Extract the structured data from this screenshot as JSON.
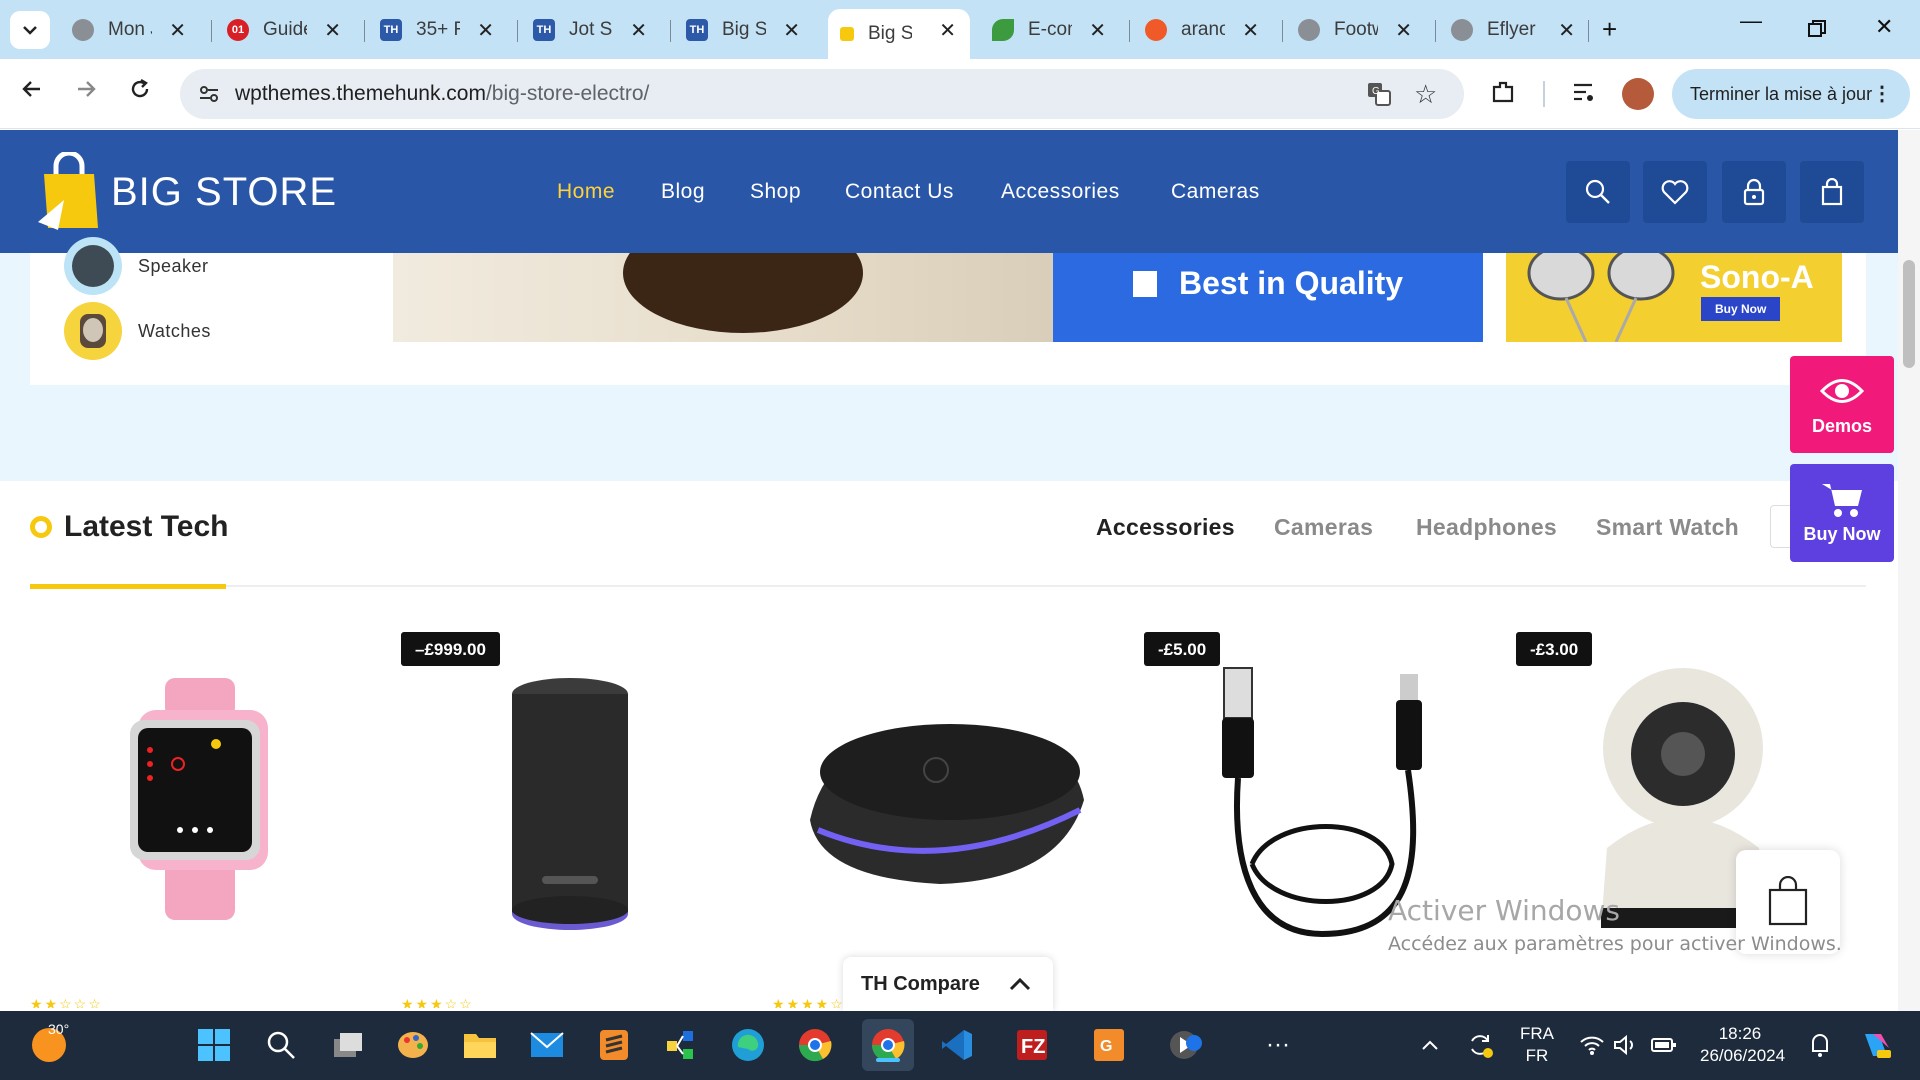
{
  "browser": {
    "tabs": [
      {
        "title": "Mon J",
        "fav_color": "#8a8f96",
        "fav_text": ""
      },
      {
        "title": "Guide",
        "fav_color": "#d91f26",
        "fav_text": "01"
      },
      {
        "title": "35+ F",
        "fav_color": "#2d5aa8",
        "fav_text": "TH"
      },
      {
        "title": "Jot Sh",
        "fav_color": "#2d5aa8",
        "fav_text": "TH"
      },
      {
        "title": "Big St",
        "fav_color": "#2d5aa8",
        "fav_text": "TH"
      },
      {
        "title": "Big St",
        "fav_color": "#f6c90e",
        "fav_text": ""
      },
      {
        "title": "E-com",
        "fav_color": "#3c9a3f",
        "fav_text": ""
      },
      {
        "title": "arano",
        "fav_color": "#f05a28",
        "fav_text": ""
      },
      {
        "title": "Footw",
        "fav_color": "#8a8f96",
        "fav_text": ""
      },
      {
        "title": "Eflyer",
        "fav_color": "#8a8f96",
        "fav_text": ""
      }
    ],
    "active_tab_index": 5,
    "url_host": "wpthemes.themehunk.com",
    "url_path": "/big-store-electro/",
    "update_button": "Terminer la mise à jour"
  },
  "site": {
    "logo": "BIG STORE",
    "nav": [
      "Home",
      "Blog",
      "Shop",
      "Contact Us",
      "Accessories",
      "Cameras"
    ],
    "active_nav": "Home",
    "categories": [
      "Speaker",
      "Watches"
    ],
    "banner_main_text": "Best in Quality",
    "banner_side_title": "Sono-A",
    "banner_side_button": "Buy Now",
    "section_title": "Latest Tech",
    "section_tabs": [
      "Accessories",
      "Cameras",
      "Headphones",
      "Smart Watch"
    ],
    "active_section_tab": "Accessories",
    "products": [
      {
        "name": "pink-watch",
        "badge": ""
      },
      {
        "name": "speaker",
        "badge": "–£999.00"
      },
      {
        "name": "wireless-charger",
        "badge": ""
      },
      {
        "name": "usb-cable",
        "badge": "-£5.00"
      },
      {
        "name": "security-camera",
        "badge": "-£3.00"
      }
    ],
    "float_demos": "Demos",
    "float_buy": "Buy Now",
    "compare_label": "TH Compare"
  },
  "windows": {
    "activate_title": "Activer Windows",
    "activate_sub": "Accédez aux paramètres pour activer Windows.",
    "weather_temp": "30°",
    "lang_top": "FRA",
    "lang_bottom": "FR",
    "time": "18:26",
    "date": "26/06/2024"
  },
  "colors": {
    "header_blue": "#2a56a8",
    "accent_yellow": "#f6c90e",
    "demos_pink": "#f1197a",
    "buy_purple": "#5e40e0"
  }
}
